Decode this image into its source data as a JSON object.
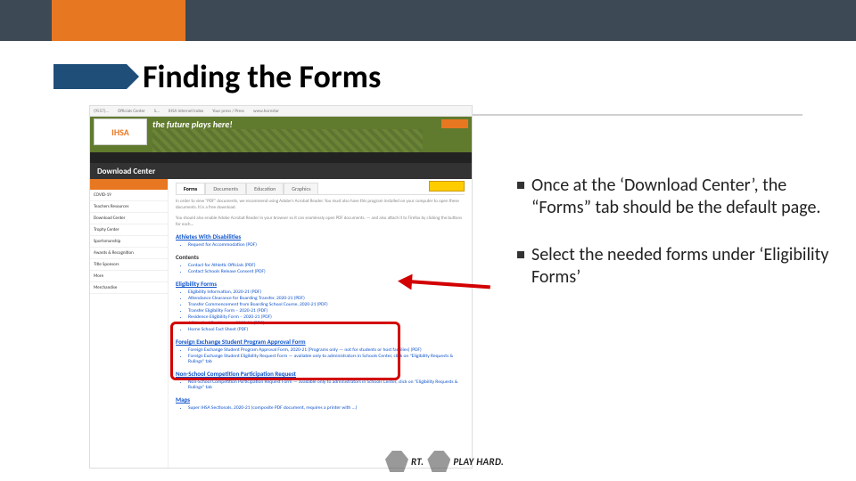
{
  "title": "Finding the Forms",
  "bullets": [
    "Once at the ‘Download Center’, the “Forms” tab should be the default page.",
    "Select the needed forms under ‘Eligibility Forms’"
  ],
  "footer": {
    "left": "RT.",
    "right": "PLAY HARD."
  },
  "screenshot": {
    "bookmarks": [
      "(9557)...",
      "Officials Center",
      "S...",
      "IHSA Internet Index",
      "Your press / Press",
      "www.hornstar"
    ],
    "logo": "IHSA",
    "tagline": "the future plays here!",
    "page_header": "Download Center",
    "sidebar_items": [
      "COVID-19",
      "Teachers Resources",
      "Download Center",
      "Trophy Center",
      "Sportsmanship",
      "Awards & Recognition",
      "Title Sponsors",
      "More",
      "Merchandise"
    ],
    "tabs": [
      "Forms",
      "Documents",
      "Education",
      "Graphics"
    ],
    "intro": "In order to view \"PDF\" documents, we recommend using Adobe's Acrobat Reader. You must also have this program installed on your computer to open these documents. It is a free download.",
    "adobe_note": "You should also enable Adobe Acrobat Reader in your browser so it can seamlessly open PDF documents. — and also attach it to Firefox by clicking the buttons for each...",
    "sections": [
      {
        "heading": "Athletes With Disabilities",
        "contents_label": "Contents",
        "items": [
          "Request for Accommodation (PDF)"
        ],
        "extra": [
          "Contact for Athletic Officials (PDF)",
          "Contact Schools Release Consent (PDF)"
        ]
      },
      {
        "heading": "Eligibility Forms",
        "items": [
          "Eligibility Information, 2020-21 (PDF)",
          "Attendance Clearance for Boarding Transfer, 2020-21 (PDF)",
          "Transfer Commencement from Boarding School Course, 2020-21 (PDF)",
          "Transfer Eligibility Form – 2020-21 (PDF)",
          "Residence Eligibility Form – 2020-21 (PDF)",
          "Affidavit of Residence – 2020-21 (PDF)",
          "Home School Fact Sheet (PDF)"
        ]
      },
      {
        "heading": "Foreign Exchange Student Program Approval Form",
        "items": [
          "Foreign Exchange Student Program Approval Form, 2020-21 (Programs only — not for students or host families) (PDF)",
          "Foreign Exchange Student Eligibility Request Form — available only to administrators in Schools Center, click on \"Eligibility Requests & Rulings\" tab"
        ]
      },
      {
        "heading": "Non-School Competition Participation Request",
        "items": [
          "Non-School Competition Participation Request Form — available only to administrators in Schools Center, click on \"Eligibility Requests & Rulings\" tab"
        ]
      },
      {
        "heading": "Maps",
        "items": [
          "Super IHSA Sectionals, 2020-21 (composite PDF document, requires a printer with ...)"
        ]
      }
    ]
  }
}
